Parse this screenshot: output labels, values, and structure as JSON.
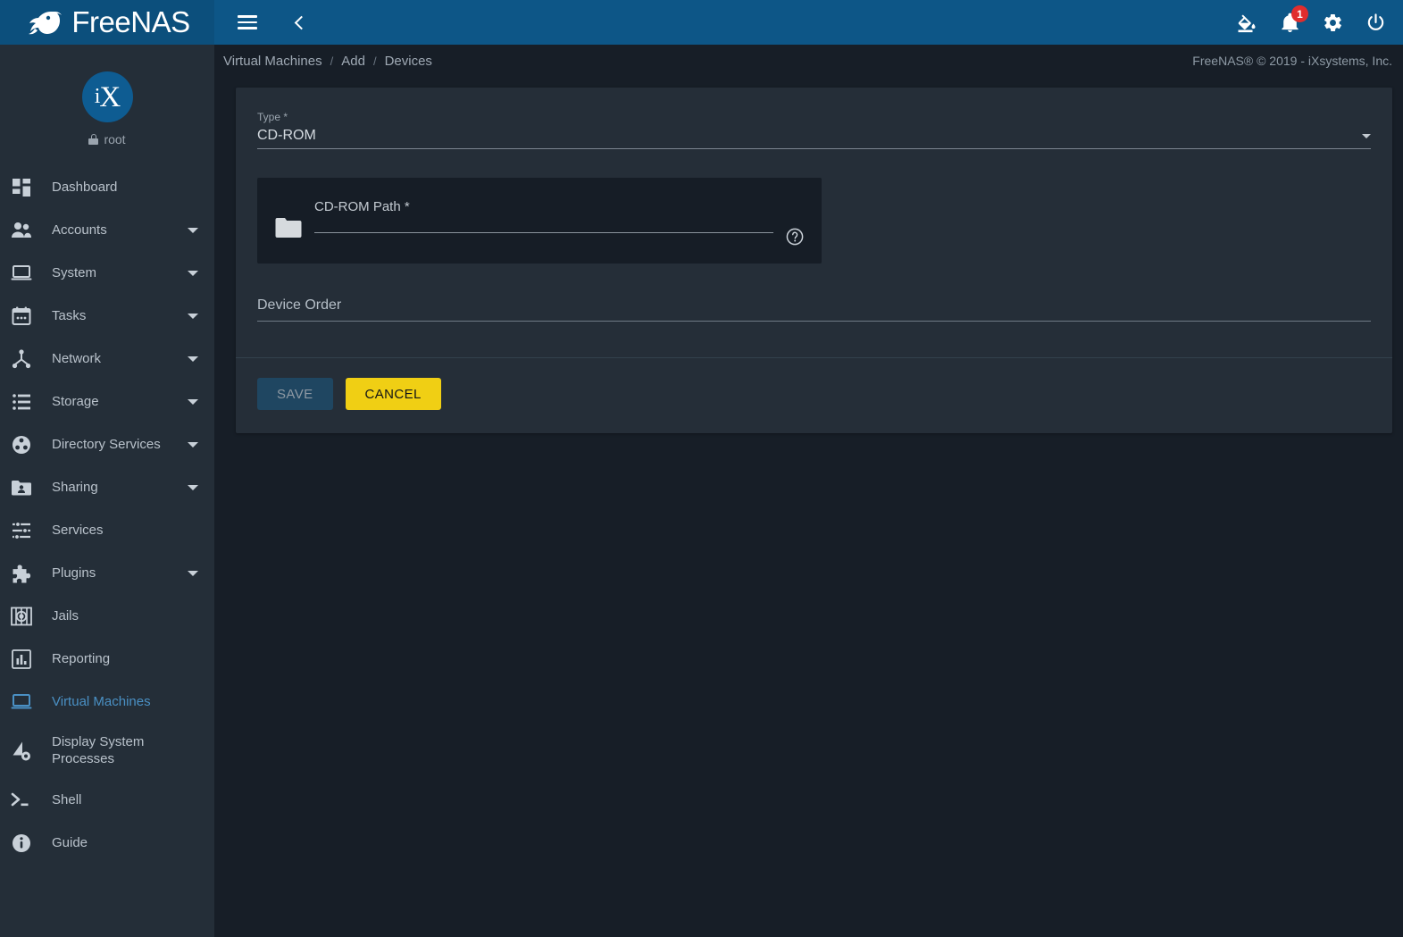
{
  "brand": {
    "name": "FreeNAS",
    "trademark": "™",
    "avatar_initials": "iX",
    "username": "root"
  },
  "topbar": {
    "menu_icon": "hamburger-icon",
    "back_icon": "chevron-left-icon",
    "theme_icon": "format-color-fill-icon",
    "notifications_icon": "bell-icon",
    "notifications_count": "1",
    "settings_icon": "gear-icon",
    "power_icon": "power-icon"
  },
  "breadcrumb": {
    "items": [
      "Virtual Machines",
      "Add",
      "Devices"
    ],
    "separator": "/"
  },
  "copyright": "FreeNAS® © 2019 - iXsystems, Inc.",
  "sidebar": {
    "items": [
      {
        "label": "Dashboard",
        "icon": "dashboard-icon",
        "expandable": false,
        "active": false
      },
      {
        "label": "Accounts",
        "icon": "people-icon",
        "expandable": true,
        "active": false
      },
      {
        "label": "System",
        "icon": "laptop-icon",
        "expandable": true,
        "active": false
      },
      {
        "label": "Tasks",
        "icon": "calendar-icon",
        "expandable": true,
        "active": false
      },
      {
        "label": "Network",
        "icon": "network-tree-icon",
        "expandable": true,
        "active": false
      },
      {
        "label": "Storage",
        "icon": "storage-list-icon",
        "expandable": true,
        "active": false
      },
      {
        "label": "Directory Services",
        "icon": "directory-services-icon",
        "expandable": true,
        "active": false
      },
      {
        "label": "Sharing",
        "icon": "folder-shared-icon",
        "expandable": true,
        "active": false
      },
      {
        "label": "Services",
        "icon": "sliders-icon",
        "expandable": false,
        "active": false
      },
      {
        "label": "Plugins",
        "icon": "puzzle-icon",
        "expandable": true,
        "active": false
      },
      {
        "label": "Jails",
        "icon": "jails-icon",
        "expandable": false,
        "active": false
      },
      {
        "label": "Reporting",
        "icon": "bar-chart-icon",
        "expandable": false,
        "active": false
      },
      {
        "label": "Virtual Machines",
        "icon": "laptop-icon",
        "expandable": false,
        "active": true
      },
      {
        "label": "Display System Processes",
        "icon": "system-processes-icon",
        "expandable": false,
        "active": false
      },
      {
        "label": "Shell",
        "icon": "terminal-icon",
        "expandable": false,
        "active": false
      },
      {
        "label": "Guide",
        "icon": "info-circle-icon",
        "expandable": false,
        "active": false
      }
    ]
  },
  "form": {
    "type_field": {
      "label": "Type *",
      "value": "CD-ROM",
      "arrow_icon": "dropdown-arrow-icon"
    },
    "cdrom_path": {
      "label": "CD-ROM Path *",
      "value": "",
      "folder_icon": "folder-icon",
      "help_icon": "help-circle-icon"
    },
    "device_order": {
      "label": "Device Order",
      "value": ""
    }
  },
  "actions": {
    "save_label": "SAVE",
    "cancel_label": "CANCEL"
  },
  "colors": {
    "header_blue": "#0d5687",
    "accent_yellow": "#f0cf14",
    "badge_red": "#e02d2d",
    "active_link": "#4a90c4"
  }
}
